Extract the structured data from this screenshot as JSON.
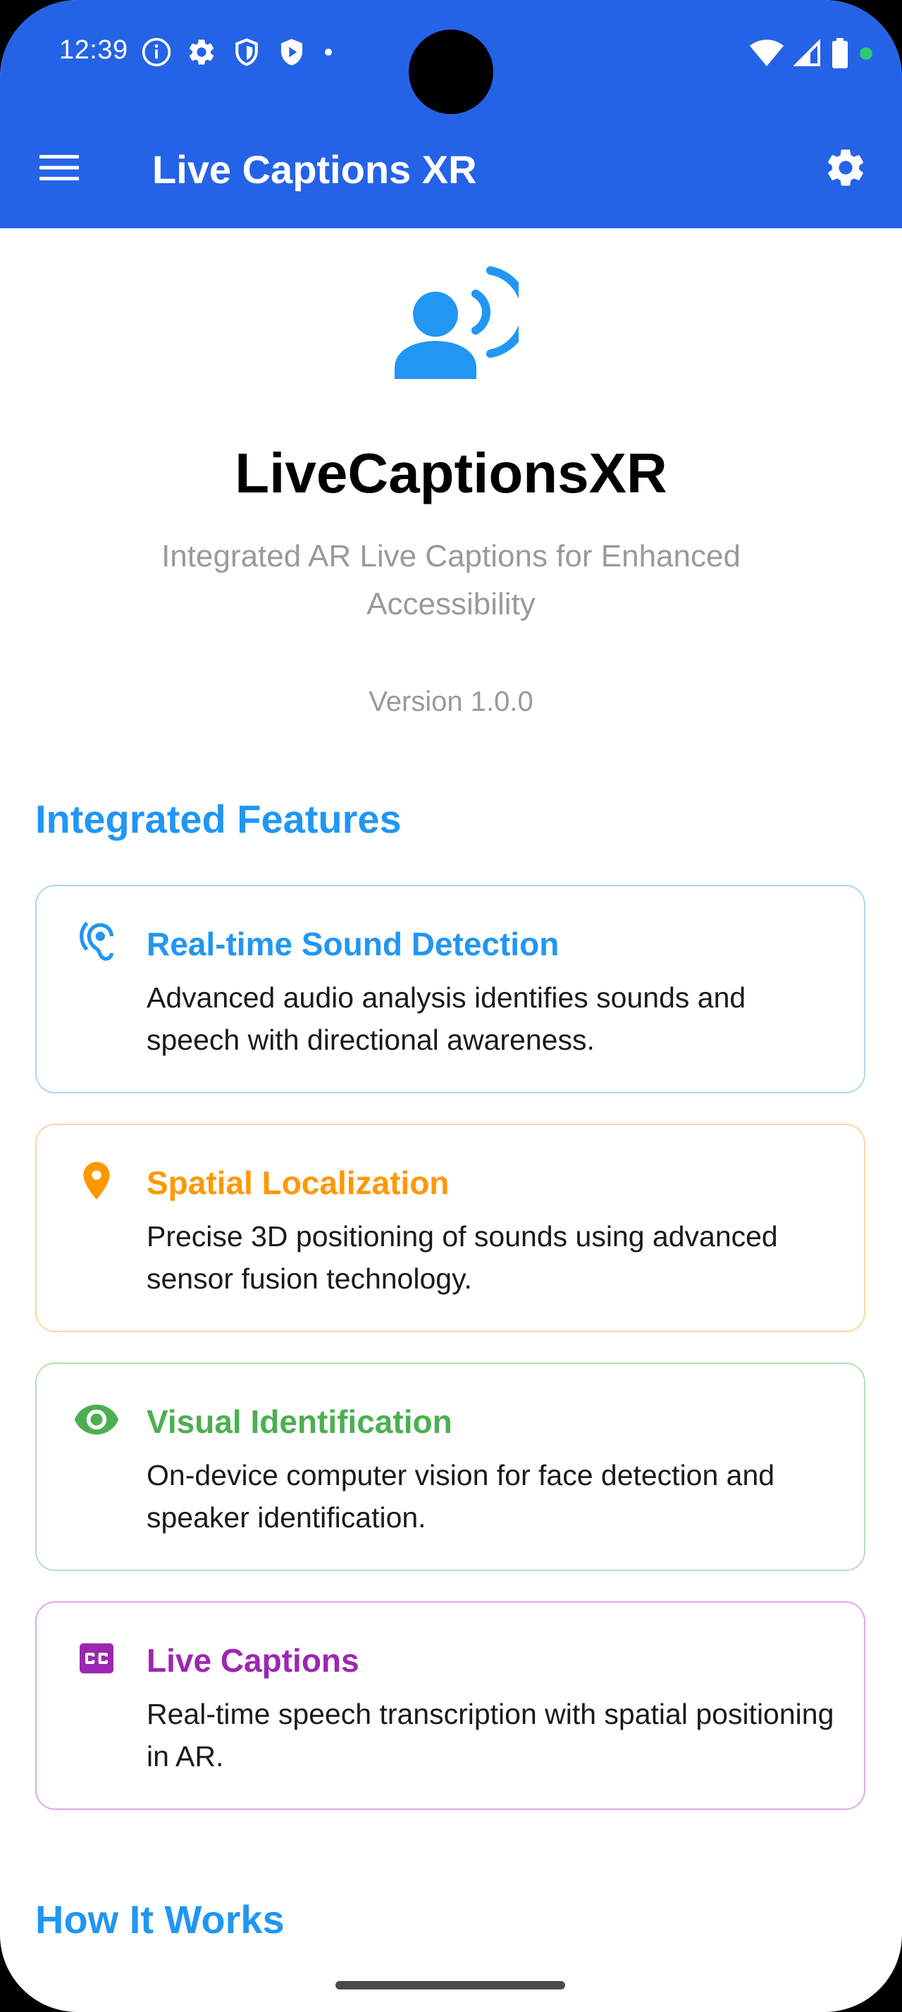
{
  "status_bar": {
    "time": "12:39"
  },
  "app_bar": {
    "title": "Live Captions XR"
  },
  "hero": {
    "title": "LiveCaptionsXR",
    "subtitle": "Integrated AR Live Captions for Enhanced Accessibility",
    "version": "Version 1.0.0"
  },
  "features_section": {
    "title": "Integrated Features",
    "items": [
      {
        "icon": "ear-icon",
        "title": "Real-time Sound Detection",
        "description": "Advanced audio analysis identifies sounds and speech with directional awareness.",
        "color": "#2196f3",
        "border_color": "#a9d6f7"
      },
      {
        "icon": "location-pin-icon",
        "title": "Spatial Localization",
        "description": "Precise 3D positioning of sounds using advanced sensor fusion technology.",
        "color": "#ff9800",
        "border_color": "#fbd6a0"
      },
      {
        "icon": "eye-icon",
        "title": "Visual Identification",
        "description": "On-device computer vision for face detection and speaker identification.",
        "color": "#4caf50",
        "border_color": "#b9dcb9"
      },
      {
        "icon": "closed-caption-icon",
        "title": "Live Captions",
        "description": "Real-time speech transcription with spatial positioning in AR.",
        "color": "#9c27b0",
        "border_color": "#dfa8e8"
      }
    ]
  },
  "how_it_works_section": {
    "title": "How It Works"
  },
  "colors": {
    "app_bar": "#2563e6",
    "accent": "#2196f3",
    "muted_text": "#9a9a9a"
  }
}
